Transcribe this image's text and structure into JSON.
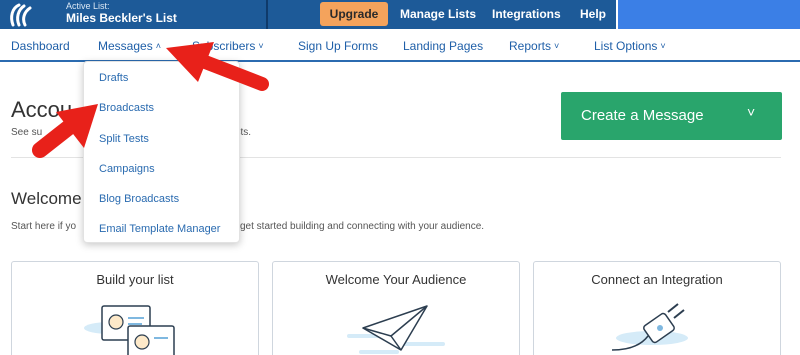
{
  "topbar": {
    "active_list_label": "Active List:",
    "active_list_name": "Miles Beckler's List",
    "upgrade": "Upgrade",
    "links": [
      "Manage Lists",
      "Integrations",
      "Help"
    ]
  },
  "nav": {
    "dashboard": "Dashboard",
    "messages": "Messages",
    "subscribers": "Subscribers",
    "sign_up_forms": "Sign Up Forms",
    "landing_pages": "Landing Pages",
    "reports": "Reports",
    "list_options": "List Options"
  },
  "dropdown": {
    "items": [
      "Drafts",
      "Broadcasts",
      "Split Tests",
      "Campaigns",
      "Blog Broadcasts",
      "Email Template Manager"
    ]
  },
  "page": {
    "title_visible": "Accou",
    "subtitle_left": "See su",
    "subtitle_right": "lists.",
    "create_button": "Create a Message",
    "welcome_title": "Welcome",
    "welcome_sub_left": "Start here if yo",
    "welcome_sub_right": "get started building and connecting with your audience."
  },
  "cards": [
    {
      "title": "Build your list"
    },
    {
      "title": "Welcome Your Audience"
    },
    {
      "title": "Connect an Integration"
    }
  ],
  "colors": {
    "topbar": "#1d5a98",
    "upgrade": "#f4a35c",
    "nav_text": "#1f5fa8",
    "create_button": "#29a56c",
    "annotation_arrow": "#e8211a"
  },
  "icons": [
    "aweber-logo-icon",
    "chevron-up-icon",
    "chevron-down-icon",
    "list-build-icon",
    "paper-plane-icon",
    "plug-icon"
  ]
}
